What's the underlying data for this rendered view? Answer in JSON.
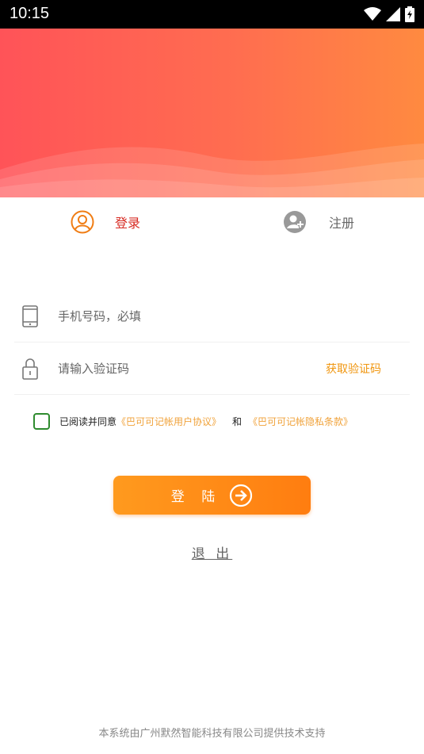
{
  "status_bar": {
    "time": "10:15"
  },
  "tabs": {
    "login": "登录",
    "register": "注册"
  },
  "form": {
    "phone_placeholder": "手机号码，必填",
    "code_placeholder": "请输入验证码",
    "get_code": "获取验证码"
  },
  "agreement": {
    "prefix": "已阅读并同意",
    "user_agreement": "《巴可可记帐用户协议》",
    "and": "和",
    "privacy_policy": "《巴可可记帐隐私条款》"
  },
  "buttons": {
    "login": "登 陆",
    "logout": "退 出"
  },
  "footer": "本系统由广州默然智能科技有限公司提供技术支持",
  "colors": {
    "accent": "#ff8c1a",
    "login_tab": "#d72a22",
    "link": "#f0a23a",
    "checkbox": "#2e8b2e"
  }
}
